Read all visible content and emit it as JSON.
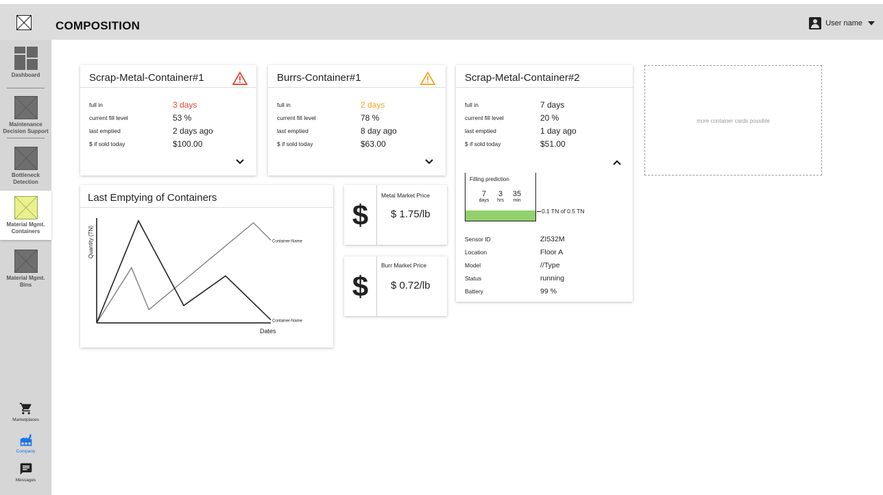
{
  "header": {
    "title": "COMPOSITION",
    "user_name": "User name"
  },
  "sidebar": {
    "items": [
      {
        "label": "Dashboard"
      },
      {
        "label": "Maintenance Decision Support"
      },
      {
        "label": "Bottleneck Detection"
      },
      {
        "label": "Material Mgmt. Containers"
      },
      {
        "label": "Material Mgmt. Bins"
      }
    ],
    "bottom": [
      {
        "label": "Marketplaces",
        "icon": "cart-icon"
      },
      {
        "label": "Company",
        "icon": "factory-icon",
        "color": "#1a73e8"
      },
      {
        "label": "Messages",
        "icon": "message-icon"
      }
    ]
  },
  "containers": [
    {
      "title": "Scrap-Metal-Container#1",
      "warning": "red",
      "rows": [
        {
          "label": "full in",
          "value": "3 days"
        },
        {
          "label": "current fill level",
          "value": "53 %"
        },
        {
          "label": "last emptied",
          "value": "2 days ago"
        },
        {
          "label": "$ if sold today",
          "value": "$100.00"
        }
      ]
    },
    {
      "title": "Burrs-Container#1",
      "warning": "orange",
      "rows": [
        {
          "label": "full in",
          "value": "2 days"
        },
        {
          "label": "current fill level",
          "value": "78 %"
        },
        {
          "label": "last emptied",
          "value": "8 day ago"
        },
        {
          "label": "$ if sold today",
          "value": "$63.00"
        }
      ]
    },
    {
      "title": "Scrap-Metal-Container#2",
      "rows": [
        {
          "label": "full in",
          "value": "7 days"
        },
        {
          "label": "current fill level",
          "value": "20 %"
        },
        {
          "label": "last emptied",
          "value": "1 day ago"
        },
        {
          "label": "$ if sold today",
          "value": "$51.00"
        }
      ],
      "prediction": {
        "title": "Filling prediction",
        "days": "7",
        "days_unit": "days",
        "hrs": "3",
        "hrs_unit": "hrs",
        "min": "35",
        "min_unit": "min",
        "fill_label": "0.1 TN of 0.5 TN",
        "fill_fraction": 0.2
      },
      "sensor": [
        {
          "label": "Sensor ID",
          "value": "ZI532M"
        },
        {
          "label": "Location",
          "value": "Floor A"
        },
        {
          "label": "Model",
          "value": "//Type"
        },
        {
          "label": "Status",
          "value": "running"
        },
        {
          "label": "Battery",
          "value": "99 %"
        }
      ]
    }
  ],
  "more_cards_text": "more container cards possible",
  "prices": [
    {
      "title": "Metal Market Price",
      "value": "$ 1.75/lb",
      "icon": "dollar-icon"
    },
    {
      "title": "Burr Market Price",
      "value": "$ 0.72/lb",
      "icon": "dollar-icon"
    }
  ],
  "colors": {
    "warning_red": "#e8432d",
    "warning_orange": "#f5a524",
    "fill_green": "#92d16d",
    "active_thumb": "#e9f08c"
  },
  "chart_data": {
    "type": "line",
    "title": "Last Emptying of Containers",
    "xlabel": "Dates",
    "ylabel": "Quantity (TN)",
    "grid": false,
    "series": [
      {
        "name": "Container-Name",
        "color": "#888888",
        "points": [
          [
            0,
            0
          ],
          [
            2,
            54
          ],
          [
            3,
            13
          ],
          [
            9,
            98
          ],
          [
            10,
            81
          ]
        ]
      },
      {
        "name": "Container-Name",
        "color": "#222222",
        "points": [
          [
            0,
            0
          ],
          [
            2.4,
            100
          ],
          [
            5,
            17
          ],
          [
            7.4,
            46
          ],
          [
            10,
            3
          ]
        ]
      }
    ],
    "xlim": [
      0,
      10
    ],
    "ylim": [
      0,
      100
    ]
  }
}
